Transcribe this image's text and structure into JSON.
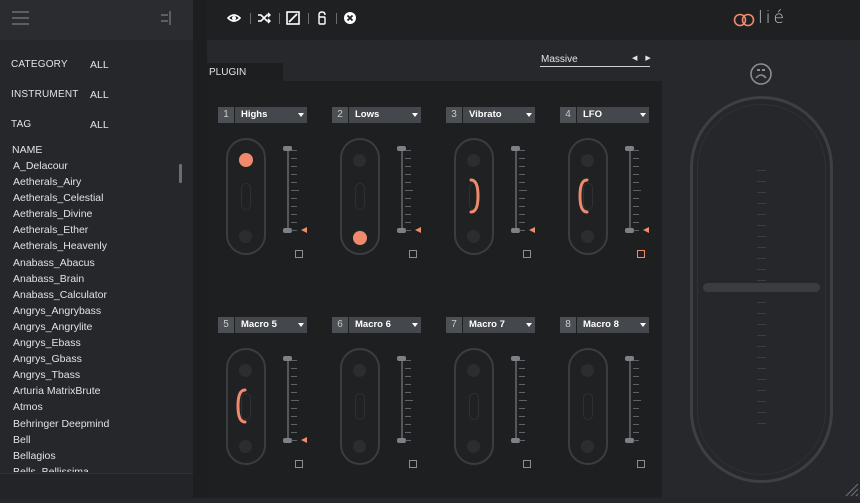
{
  "topbar": {
    "icons": [
      "eye-icon",
      "shuffle-icon",
      "edit-icon",
      "lock-icon",
      "close-circle-icon"
    ],
    "brand": "lié"
  },
  "filters": [
    {
      "label": "CATEGORY",
      "value": "ALL"
    },
    {
      "label": "INSTRUMENT",
      "value": "ALL"
    },
    {
      "label": "TAG",
      "value": "ALL"
    }
  ],
  "presets": {
    "header": "NAME",
    "items": [
      "A_Delacour",
      "Aetherals_Airy",
      "Aetherals_Celestial",
      "Aetherals_Divine",
      "Aetherals_Ether",
      "Aetherals_Heavenly",
      "Anabass_Abacus",
      "Anabass_Brain",
      "Anabass_Calculator",
      "Angrys_Angrybass",
      "Angrys_Angrylite",
      "Angrys_Ebass",
      "Angrys_Gbass",
      "Angrys_Tbass",
      "Arturia MatrixBrute",
      "Atmos",
      "Behringer Deepmind",
      "Bell",
      "Bellagios",
      "Bells_Bellissima"
    ]
  },
  "plugin": {
    "tab_label": "PLUGIN",
    "selected": "Massive"
  },
  "macros": [
    {
      "num": "1",
      "name": "Highs",
      "dot": "top",
      "arrow": true,
      "toggle_on": false
    },
    {
      "num": "2",
      "name": "Lows",
      "dot": "bottom",
      "arrow": true,
      "toggle_on": false
    },
    {
      "num": "3",
      "name": "Vibrato",
      "dot": "right-arc",
      "arrow": true,
      "toggle_on": false
    },
    {
      "num": "4",
      "name": "LFO",
      "dot": "left-arc",
      "arrow": true,
      "toggle_on": true
    },
    {
      "num": "5",
      "name": "Macro 5",
      "dot": "left-arc",
      "arrow": true,
      "toggle_on": false
    },
    {
      "num": "6",
      "name": "Macro 6",
      "dot": "none",
      "arrow": false,
      "toggle_on": false
    },
    {
      "num": "7",
      "name": "Macro 7",
      "dot": "none",
      "arrow": false,
      "toggle_on": false
    },
    {
      "num": "8",
      "name": "Macro 8",
      "dot": "none",
      "arrow": false,
      "toggle_on": false
    }
  ],
  "colors": {
    "accent": "#f08a6c",
    "panel": "#1d1f21",
    "background": "#25272a"
  }
}
